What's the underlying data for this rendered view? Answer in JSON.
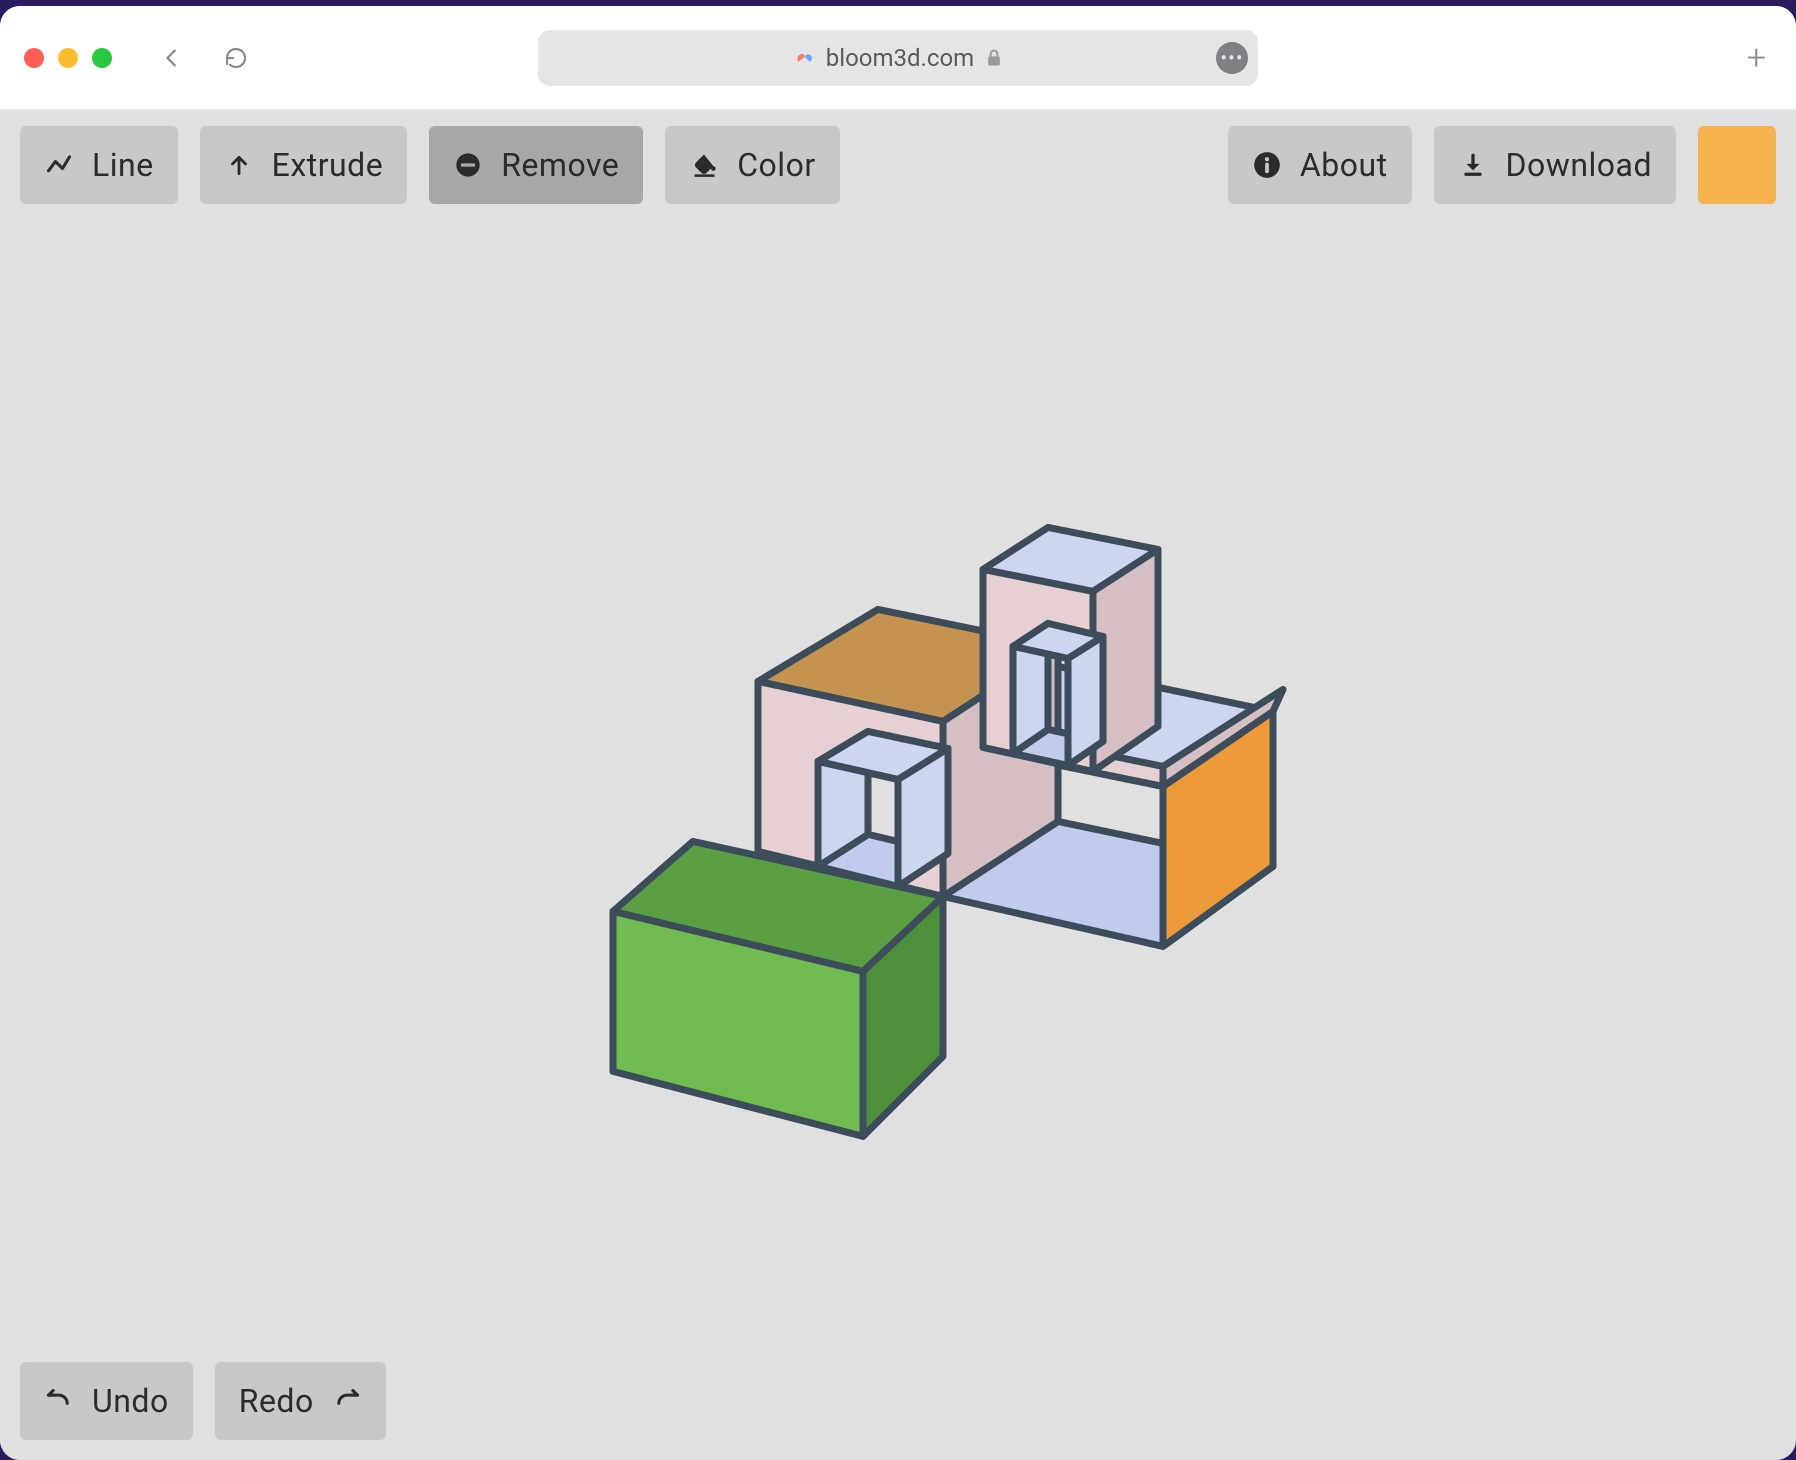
{
  "browser": {
    "url_host": "bloom3d.com"
  },
  "toolbar": {
    "line_label": "Line",
    "extrude_label": "Extrude",
    "remove_label": "Remove",
    "color_label": "Color",
    "about_label": "About",
    "download_label": "Download",
    "active_tool": "remove",
    "swatch_color": "#f6b24d"
  },
  "bottombar": {
    "undo_label": "Undo",
    "redo_label": "Redo"
  },
  "scene": {
    "stroke": "#3d4c5a",
    "colors": {
      "green_top": "#5aa043",
      "green_front": "#6fbb4f",
      "green_side": "#4d8f3a",
      "tan": "#c49350",
      "pink": "#e6d0d3",
      "pink_shadow": "#d6bfc3",
      "orange": "#ed9a3a",
      "blue_light": "#cdd5f0",
      "blue_floor": "#c0cbee"
    }
  }
}
